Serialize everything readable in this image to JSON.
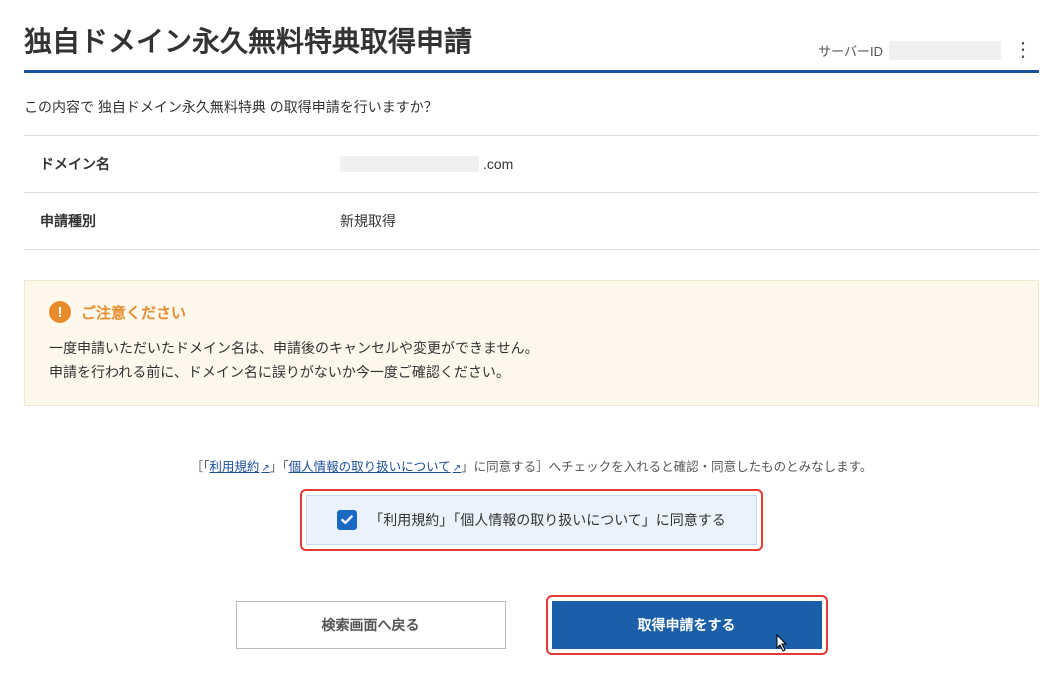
{
  "header": {
    "title": "独自ドメイン永久無料特典取得申請",
    "server_id_label": "サーバーID"
  },
  "intro": "この内容で 独自ドメイン永久無料特典 の取得申請を行いますか？",
  "table": {
    "domain_label": "ドメイン名",
    "domain_suffix": ".com",
    "type_label": "申請種別",
    "type_value": "新規取得"
  },
  "notice": {
    "title": "ご注意ください",
    "line1": "一度申請いただいたドメイン名は、申請後のキャンセルや変更ができません。",
    "line2": "申請を行われる前に、ドメイン名に誤りがないか今一度ご確認ください。"
  },
  "terms": {
    "prefix": "［「",
    "link1": "利用規約",
    "mid1": "」「",
    "link2": "個人情報の取り扱いについて",
    "suffix": "」に同意する］へチェックを入れると確認・同意したものとみなします。"
  },
  "consent": {
    "label": "「利用規約」「個人情報の取り扱いについて」に同意する"
  },
  "buttons": {
    "back": "検索画面へ戻る",
    "submit": "取得申請をする"
  }
}
